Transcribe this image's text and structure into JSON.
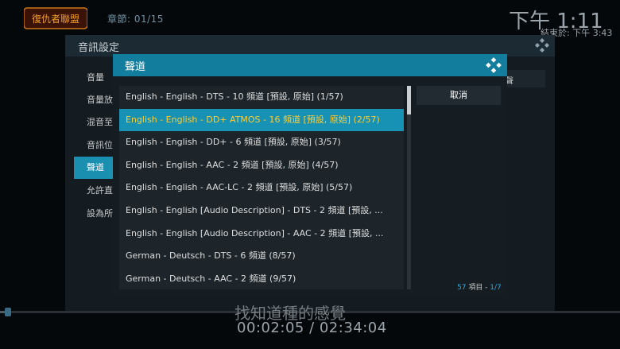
{
  "osd": {
    "logo_text": "復仇者聯盟",
    "chapter": "章節: 01/15",
    "clock": "下午 1:11",
    "end_time": "結束於: 下午 3:43",
    "subtitle": "找知道種的感覺",
    "timecode": "00:02:05 / 02:34:04",
    "progress": 0.013
  },
  "settings_dialog": {
    "title": "音訊設定",
    "items": [
      {
        "label": "音量"
      },
      {
        "label": "音量放"
      },
      {
        "label": "混音至"
      },
      {
        "label": "音訊位"
      },
      {
        "label": "聲道",
        "active": true
      },
      {
        "label": "允許直"
      },
      {
        "label": "設為所"
      }
    ],
    "right_fragment": "聲"
  },
  "channel_dialog": {
    "title": "聲道",
    "cancel_label": "取消",
    "count_number": "57",
    "count_items_label": " 項目 - ",
    "count_page": "1/7",
    "items": [
      {
        "label": "English - English - DTS  - 10 頻道 [預設, 原始] (1/57)"
      },
      {
        "label": "English - English - DD+ ATMOS  - 16 頻道 [預設, 原始] (2/57)",
        "focused": true
      },
      {
        "label": "English - English - DD+  - 6 頻道 [預設, 原始] (3/57)"
      },
      {
        "label": "English - English - AAC  - 2 頻道 [預設, 原始] (4/57)"
      },
      {
        "label": "English - English - AAC-LC  - 2 頻道 [預設, 原始] (5/57)"
      },
      {
        "label": "English - English [Audio Description] - DTS  - 2 頻道 [預設, ..."
      },
      {
        "label": "English - English [Audio Description] - AAC  - 2 頻道 [預設, ..."
      },
      {
        "label": "German - Deutsch - DTS  - 6 頻道 (8/57)"
      },
      {
        "label": "German - Deutsch - AAC  - 2 頻道 (9/57)"
      }
    ]
  },
  "colors": {
    "accent": "#1792b4",
    "focus_text": "#ffcc33",
    "header": "#127d9c"
  },
  "icons": {
    "kodi": "kodi-logo-icon"
  }
}
